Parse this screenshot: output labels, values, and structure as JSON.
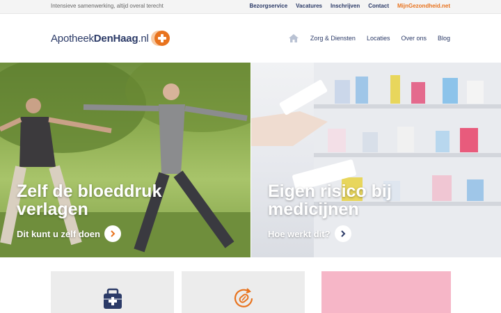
{
  "topbar": {
    "tagline": "Intensieve samenwerking, altijd overal terecht",
    "links": [
      "Bezorgservice",
      "Vacatures",
      "Inschrijven",
      "Contact"
    ],
    "accent_link": "MijnGezondheid.net"
  },
  "header": {
    "logo_prefix": "Apotheek",
    "logo_bold": "DenHaag",
    "logo_suffix": ".nl",
    "nav": [
      "Zorg & Diensten",
      "Locaties",
      "Over ons",
      "Blog"
    ]
  },
  "heroes": [
    {
      "title": "Zelf de bloeddruk verlagen",
      "cta": "Dit kunt u zelf doen"
    },
    {
      "title": "Eigen risico bij medicijnen",
      "cta": "Hoe werkt dit?"
    }
  ],
  "colors": {
    "brand_navy": "#2b3a67",
    "brand_orange": "#e8731e",
    "card_pink": "#f6b6c7",
    "card_gray": "#ececec"
  },
  "icons": [
    "home-icon",
    "chevron-right-icon",
    "medicine-box-icon",
    "refill-pill-icon"
  ]
}
